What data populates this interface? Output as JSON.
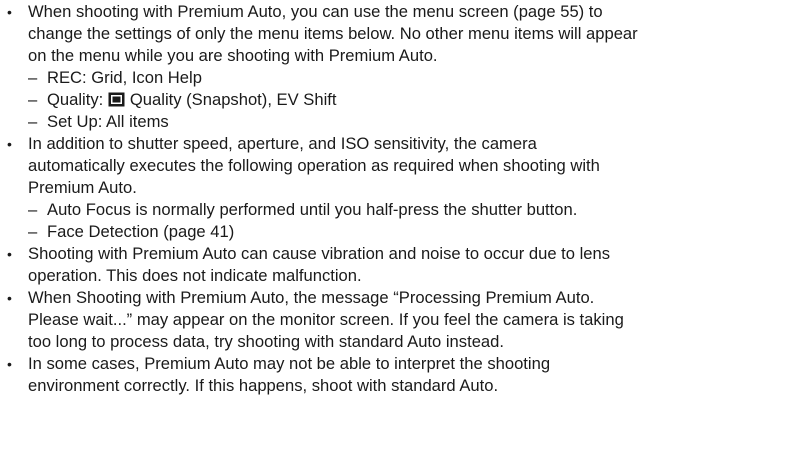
{
  "bullet_glyph": "•",
  "dash_glyph": "–",
  "bullets": [
    {
      "lines": [
        "When shooting with Premium Auto, you can use the menu screen (page 55) to",
        "change the settings of only the menu items below. No other menu items will appear",
        "on the menu while you are shooting with Premium Auto."
      ],
      "subitems": [
        {
          "text": "REC: Grid, Icon Help"
        },
        {
          "prefix": "Quality:",
          "icon": "image-quality-icon",
          "text": "Quality (Snapshot), EV Shift"
        },
        {
          "text": "Set Up: All items"
        }
      ]
    },
    {
      "lines": [
        "In addition to shutter speed, aperture, and ISO sensitivity, the camera",
        "automatically executes the following operation as required when shooting with",
        "Premium Auto."
      ],
      "subitems": [
        {
          "text": "Auto Focus is normally performed until you half-press the shutter button."
        },
        {
          "text": "Face Detection (page 41)"
        }
      ]
    },
    {
      "lines": [
        "Shooting with Premium Auto can cause vibration and noise to occur due to lens",
        "operation. This does not indicate malfunction."
      ]
    },
    {
      "lines": [
        "When Shooting with Premium Auto, the message “Processing Premium Auto.",
        "Please wait...” may appear on the monitor screen. If you feel the camera is taking",
        "too long to process data, try shooting with standard Auto instead."
      ]
    },
    {
      "lines": [
        "In some cases, Premium Auto may not be able to interpret the shooting",
        "environment correctly. If this happens, shoot with standard Auto."
      ]
    }
  ]
}
